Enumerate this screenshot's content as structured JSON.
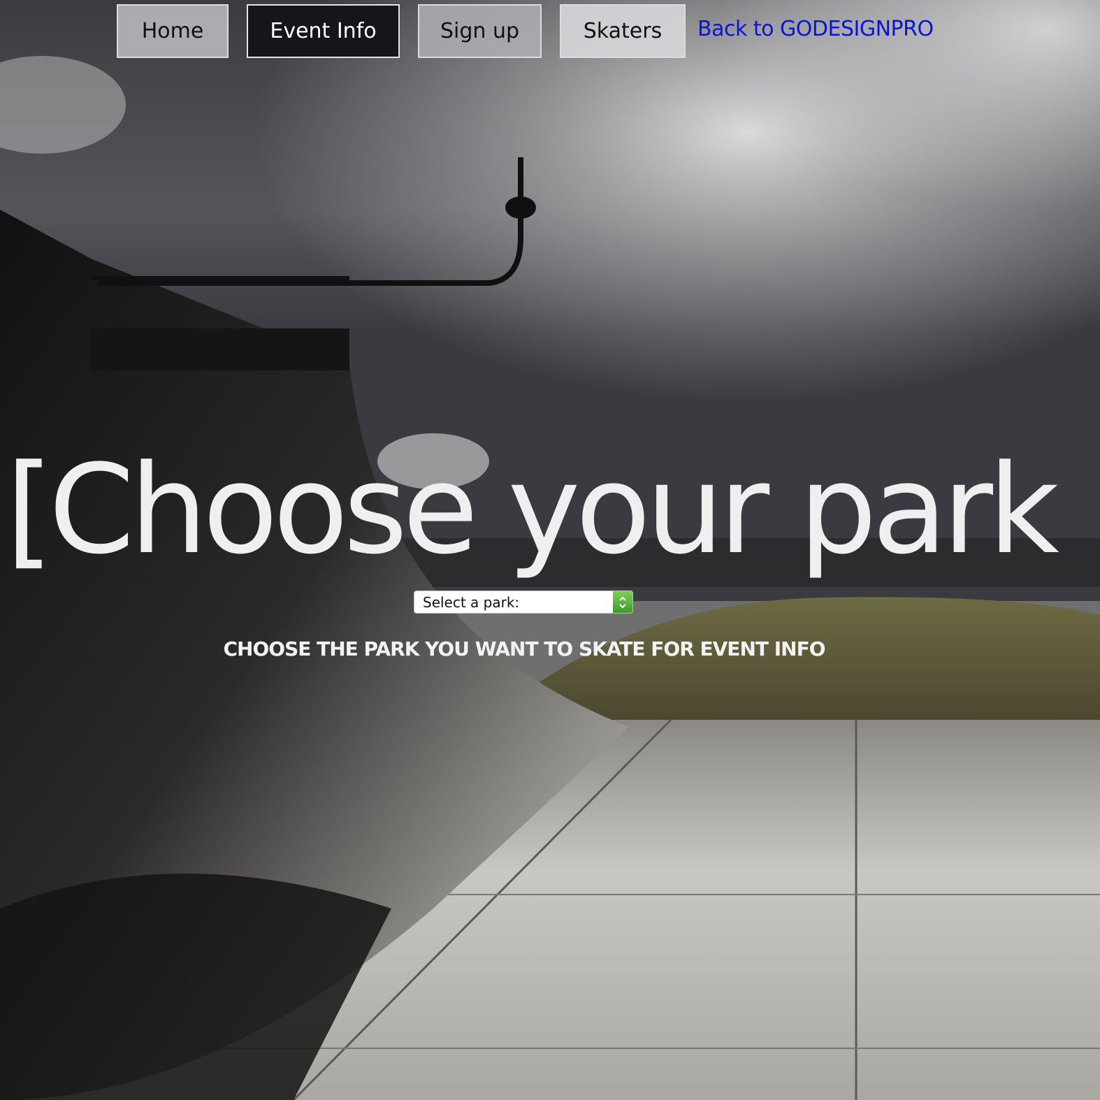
{
  "nav": {
    "home_label": "Home",
    "event_info_label": "Event Info",
    "signup_label": "Sign up",
    "skaters_label": "Skaters",
    "back_link_label": "Back to GODESIGNPRO",
    "link_color": "#0a14d6",
    "active_item": "Event Info"
  },
  "hero": {
    "title": "[Choose your park",
    "park_select": {
      "selected": "Select a park:",
      "arrow_icon": "select-stepper-icon",
      "arrow_color": "#4aa532"
    },
    "instruction": "CHOOSE THE PARK YOU WANT TO SKATE FOR EVENT INFO"
  },
  "background": {
    "description_icon": "skatepark-halfpipe-photo"
  }
}
